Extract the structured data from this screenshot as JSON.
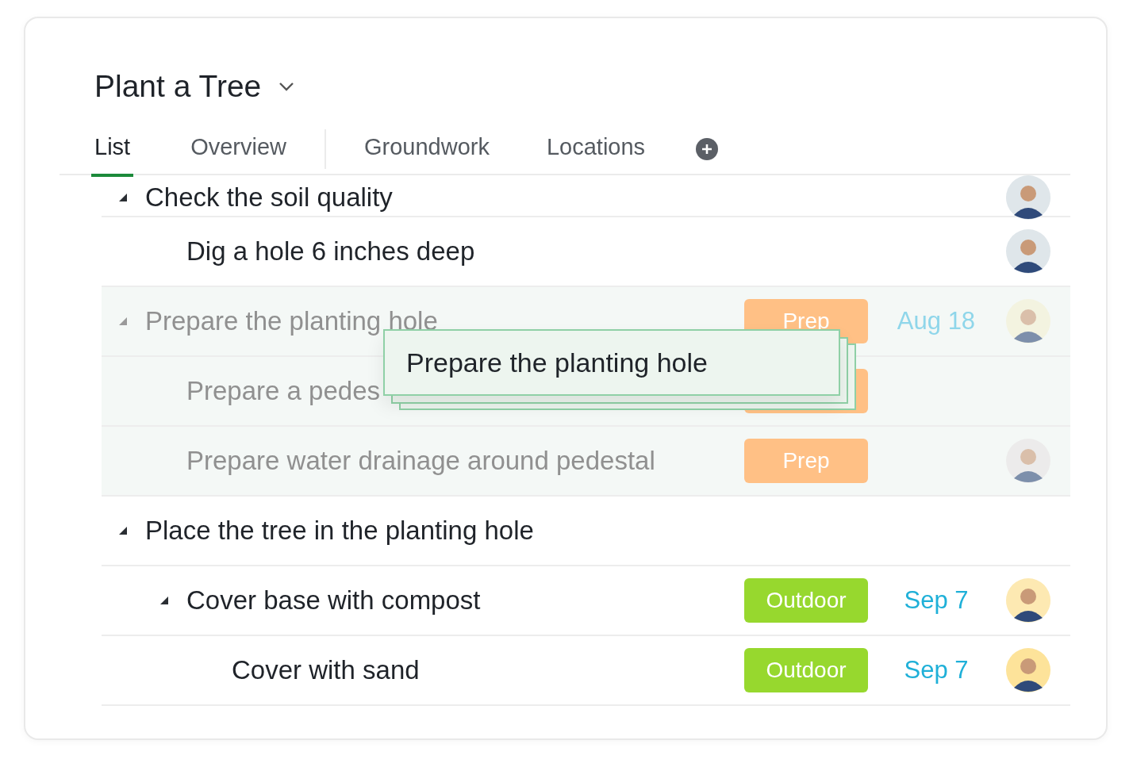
{
  "project": {
    "title": "Plant a Tree"
  },
  "tabs": [
    {
      "label": "List",
      "selected": true
    },
    {
      "label": "Overview",
      "selected": false
    },
    {
      "label": "Groundwork",
      "selected": false
    },
    {
      "label": "Locations",
      "selected": false
    }
  ],
  "rows": [
    {
      "name": "Check the soil quality",
      "expanded": true,
      "dragging": false,
      "avatar": {
        "color": "#dfe6ea"
      },
      "children": [
        {
          "name": "Dig a hole 6 inches deep",
          "dragging": false,
          "avatar": {
            "color": "#dfe6ea"
          }
        }
      ]
    },
    {
      "name": "Prepare the planting hole",
      "expanded": true,
      "dragging": true,
      "tag": {
        "label": "Prep",
        "color": "#ffc085"
      },
      "date": "Aug 18",
      "avatar": {
        "color": "#f3f0d2"
      },
      "children": [
        {
          "name": "Prepare a pedes",
          "dragging": true,
          "tag": {
            "color": "#ffc085"
          }
        },
        {
          "name": "Prepare water drainage around pedestal",
          "dragging": true,
          "tag": {
            "label": "Prep",
            "color": "#ffc085"
          },
          "avatar": {
            "color": "#e8e4e4"
          }
        }
      ]
    },
    {
      "name": "Place the tree in the planting hole",
      "expanded": true,
      "dragging": false,
      "children": [
        {
          "name": "Cover base with compost",
          "expanded": true,
          "dragging": false,
          "tag": {
            "label": "Outdoor",
            "color": "#97d82e"
          },
          "date": "Sep 7",
          "avatar": {
            "color": "#fde9b2"
          },
          "children": [
            {
              "name": "Cover with sand",
              "dragging": false,
              "tag": {
                "label": "Outdoor",
                "color": "#97d82e"
              },
              "date": "Sep 7",
              "avatar": {
                "color": "#fde39a"
              }
            }
          ]
        }
      ]
    }
  ],
  "drag_ghost": {
    "label": "Prepare the planting hole"
  }
}
